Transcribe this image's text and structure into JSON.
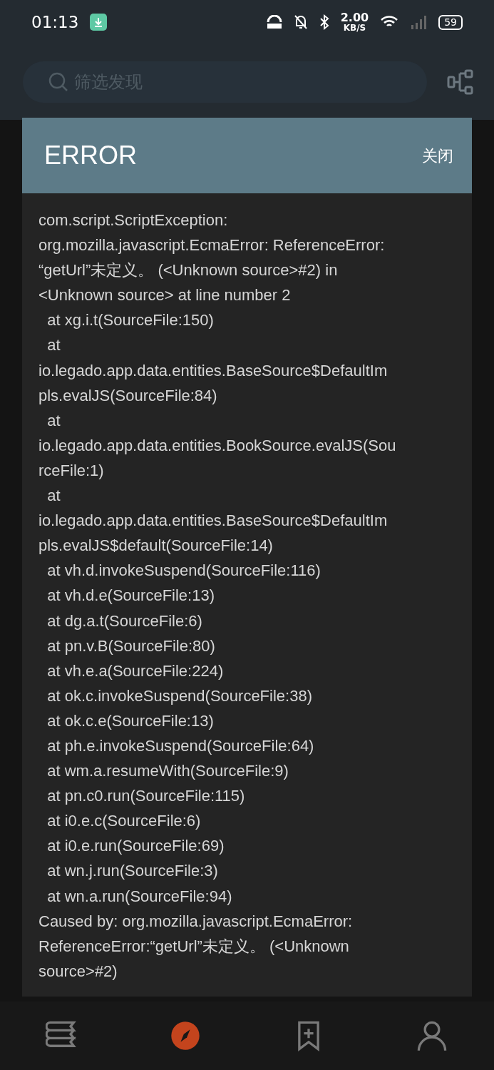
{
  "status_bar": {
    "time": "01:13",
    "speed_value": "2.00",
    "speed_unit": "KB/S",
    "battery": "59"
  },
  "search": {
    "placeholder": "筛选发现"
  },
  "dialog": {
    "title": "ERROR",
    "close_label": "关闭",
    "lines": [
      "com.script.ScriptException:",
      "org.mozilla.javascript.EcmaError: ReferenceError:",
      "“getUrl”未定义。 (<Unknown source>#2) in",
      "<Unknown source> at line number 2",
      "  at xg.i.t(SourceFile:150)",
      "  at",
      "io.legado.app.data.entities.BaseSource$DefaultIm",
      "pls.evalJS(SourceFile:84)",
      "  at",
      "io.legado.app.data.entities.BookSource.evalJS(Sou",
      "rceFile:1)",
      "  at",
      "io.legado.app.data.entities.BaseSource$DefaultIm",
      "pls.evalJS$default(SourceFile:14)",
      "  at vh.d.invokeSuspend(SourceFile:116)",
      "  at vh.d.e(SourceFile:13)",
      "  at dg.a.t(SourceFile:6)",
      "  at pn.v.B(SourceFile:80)",
      "  at vh.e.a(SourceFile:224)",
      "  at ok.c.invokeSuspend(SourceFile:38)",
      "  at ok.c.e(SourceFile:13)",
      "  at ph.e.invokeSuspend(SourceFile:64)",
      "  at wm.a.resumeWith(SourceFile:9)",
      "  at pn.c0.run(SourceFile:115)",
      "  at i0.e.c(SourceFile:6)",
      "  at i0.e.run(SourceFile:69)",
      "  at wn.j.run(SourceFile:3)",
      "  at wn.a.run(SourceFile:94)",
      "Caused by: org.mozilla.javascript.EcmaError:",
      "ReferenceError:“getUrl”未定义。 (<Unknown",
      "source>#2)"
    ]
  },
  "bottom_nav": [
    {
      "kind": "bookshelf",
      "selected": false
    },
    {
      "kind": "discover",
      "selected": true
    },
    {
      "kind": "bookmark",
      "selected": false
    },
    {
      "kind": "profile",
      "selected": false
    }
  ]
}
